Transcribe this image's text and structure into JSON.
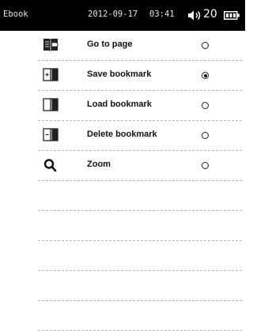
{
  "status_bar": {
    "title": "Ebook",
    "date": "2012-09-17",
    "time": "03:41",
    "volume": "20",
    "speaker_icon": "speaker-icon",
    "battery_icon": "battery-icon"
  },
  "menu": {
    "items": [
      {
        "label": "Go to page",
        "icon": "book-goto-icon",
        "selected": false
      },
      {
        "label": "Save bookmark",
        "icon": "bookmark-save-icon",
        "selected": true
      },
      {
        "label": "Load bookmark",
        "icon": "bookmark-load-icon",
        "selected": false
      },
      {
        "label": "Delete bookmark",
        "icon": "bookmark-delete-icon",
        "selected": false
      },
      {
        "label": "Zoom",
        "icon": "zoom-icon",
        "selected": false
      }
    ]
  },
  "colors": {
    "status_bar_bg": "#000000",
    "status_text": "#ffffff",
    "separator": "#b5b5b5"
  }
}
